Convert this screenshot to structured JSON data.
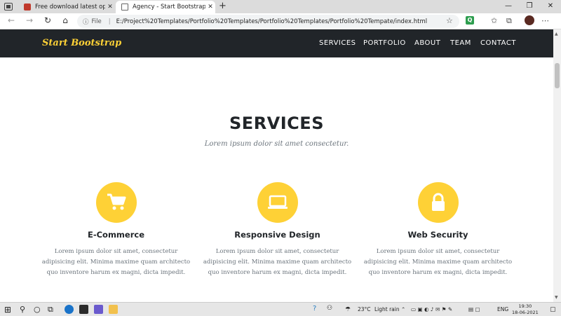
{
  "browser": {
    "tabs": [
      {
        "title": "Free download latest open sour",
        "active": false
      },
      {
        "title": "Agency - Start Bootstrap Theme",
        "active": true
      }
    ],
    "address": {
      "info_label": "File",
      "url": "E:/Project%20Templates/Portfolio%20Templates/Portfolio%20Templates/Portfolio%20Tempate/index.html"
    },
    "extension_q": "Q"
  },
  "site": {
    "brand": "Start Bootstrap",
    "nav": [
      "SERVICES",
      "PORTFOLIO",
      "ABOUT",
      "TEAM",
      "CONTACT"
    ],
    "section": {
      "heading": "SERVICES",
      "subheading": "Lorem ipsum dolor sit amet consectetur."
    },
    "services": [
      {
        "icon": "shopping-cart-icon",
        "title": "E-Commerce",
        "text": "Lorem ipsum dolor sit amet, consectetur adipisicing elit. Minima maxime quam architecto quo inventore harum ex magni, dicta impedit."
      },
      {
        "icon": "laptop-icon",
        "title": "Responsive Design",
        "text": "Lorem ipsum dolor sit amet, consectetur adipisicing elit. Minima maxime quam architecto quo inventore harum ex magni, dicta impedit."
      },
      {
        "icon": "lock-icon",
        "title": "Web Security",
        "text": "Lorem ipsum dolor sit amet, consectetur adipisicing elit. Minima maxime quam architecto quo inventore harum ex magni, dicta impedit."
      }
    ]
  },
  "taskbar": {
    "weather_temp": "23°C",
    "weather_text": "Light rain",
    "language": "ENG",
    "time": "19:30",
    "date": "18-06-2021"
  },
  "colors": {
    "accent": "#fed136",
    "navbar": "#212529",
    "heading": "#212529",
    "muted": "#6c757d"
  }
}
